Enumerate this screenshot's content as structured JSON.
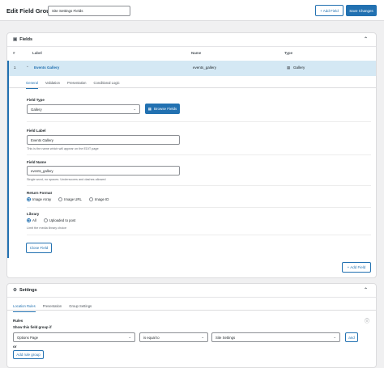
{
  "header": {
    "title": "Edit Field Group",
    "group_title_value": "Site Settings Fields",
    "add_field_label": "+ Add Field",
    "save_label": "Save Changes"
  },
  "fields_panel": {
    "title": "Fields",
    "columns": [
      "#",
      "Label",
      "Name",
      "Type"
    ],
    "row": {
      "order": "1",
      "label": "Events Gallery",
      "name": "events_gallery",
      "type": "Gallery"
    },
    "tabs": [
      "General",
      "Validation",
      "Presentation",
      "Conditional Logic"
    ],
    "field_type": {
      "label": "Field Type",
      "value": "Gallery",
      "browse_label": "Browse Fields"
    },
    "field_label": {
      "label": "Field Label",
      "value": "Events Gallery",
      "help": "This is the name which will appear on the EDIT page"
    },
    "field_name": {
      "label": "Field Name",
      "value": "events_gallery",
      "help": "Single word, no spaces. Underscores and dashes allowed"
    },
    "return_format": {
      "label": "Return Format",
      "options": [
        "Image Array",
        "Image URL",
        "Image ID"
      ],
      "selected": "Image Array"
    },
    "library": {
      "label": "Library",
      "options": [
        "All",
        "Uploaded to post"
      ],
      "selected": "All",
      "help": "Limit the media library choice"
    },
    "close_label": "Close Field",
    "add_field_label": "+ Add Field"
  },
  "settings_panel": {
    "title": "Settings",
    "tabs": [
      "Location Rules",
      "Presentation",
      "Group Settings"
    ],
    "rules_label": "Rules",
    "rules_help": "Show this field group if",
    "param": "Options Page",
    "operator": "is equal to",
    "value": "Site Settings",
    "and_label": "and",
    "or_label": "or",
    "add_group_label": "Add rule group"
  },
  "colors": {
    "accent": "#2271b1",
    "row_highlight": "#d4e8f4",
    "background": "#f0f0f1"
  }
}
